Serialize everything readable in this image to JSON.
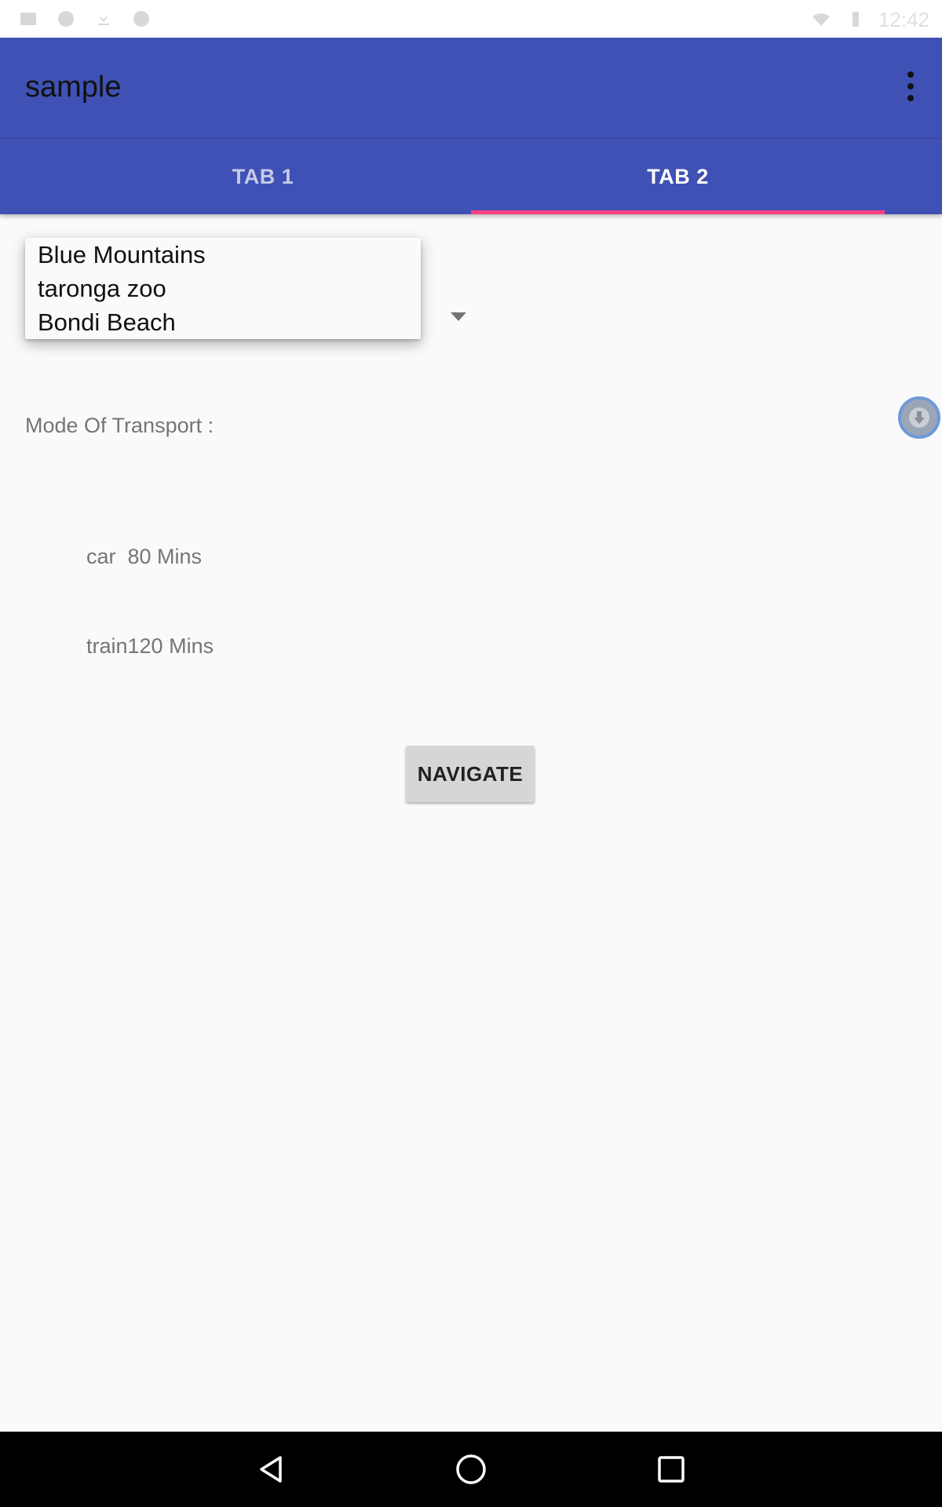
{
  "app": {
    "title": "sample"
  },
  "status_bar": {
    "time": "12:42"
  },
  "tabs": [
    {
      "label": "TAB 1",
      "selected": false
    },
    {
      "label": "TAB 2",
      "selected": true
    }
  ],
  "colors": {
    "primary": "#3f51b5",
    "accent": "#ff4081",
    "background": "#fafafa"
  },
  "dropdown": {
    "options": [
      "Blue Mountains",
      "taronga zoo",
      "Bondi Beach"
    ]
  },
  "transport": {
    "label": "Mode Of Transport :",
    "entries": [
      "car  80 Mins",
      "train120 Mins"
    ]
  },
  "actions": {
    "navigate_label": "NAVIGATE"
  },
  "icons": {
    "overflow": "more-vert-icon",
    "download": "download-icon",
    "back": "back-icon",
    "home": "home-icon",
    "recents": "recents-icon"
  }
}
